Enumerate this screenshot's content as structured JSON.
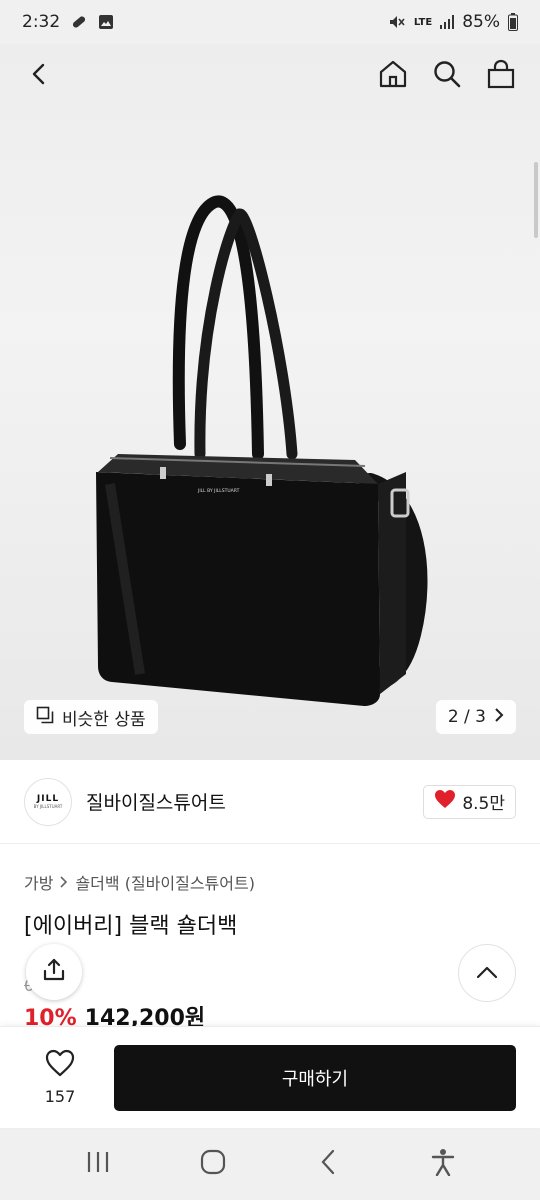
{
  "status_bar": {
    "time": "2:32",
    "network": "LTE",
    "battery": "85%",
    "icons": [
      "pill-icon",
      "image-icon",
      "mute-icon",
      "signal-icon",
      "battery-icon"
    ]
  },
  "top_nav": {
    "back": "back-icon",
    "home": "home-icon",
    "search": "search-icon",
    "cart": "shopping-bag-icon"
  },
  "gallery": {
    "similar_label": "비슷한 상품",
    "pager": "2 / 3",
    "bag_brand_text": "JILL BY JILLSTUART"
  },
  "brand": {
    "logo_line1": "JILL",
    "logo_line2": "BY JILLSTUART",
    "name": "질바이질스튜어트",
    "likes": "8.5만"
  },
  "product": {
    "breadcrumb": [
      "가방",
      "숄더백 (질바이질스튜어트)"
    ],
    "title": "[에이버리] 블랙 숄더백",
    "original_price": "00원",
    "discount": "10%",
    "price": "142,200원"
  },
  "action_bar": {
    "wish_count": "157",
    "buy_label": "구매하기"
  },
  "colors": {
    "accent_red": "#e0202a",
    "buy_button": "#111111"
  }
}
